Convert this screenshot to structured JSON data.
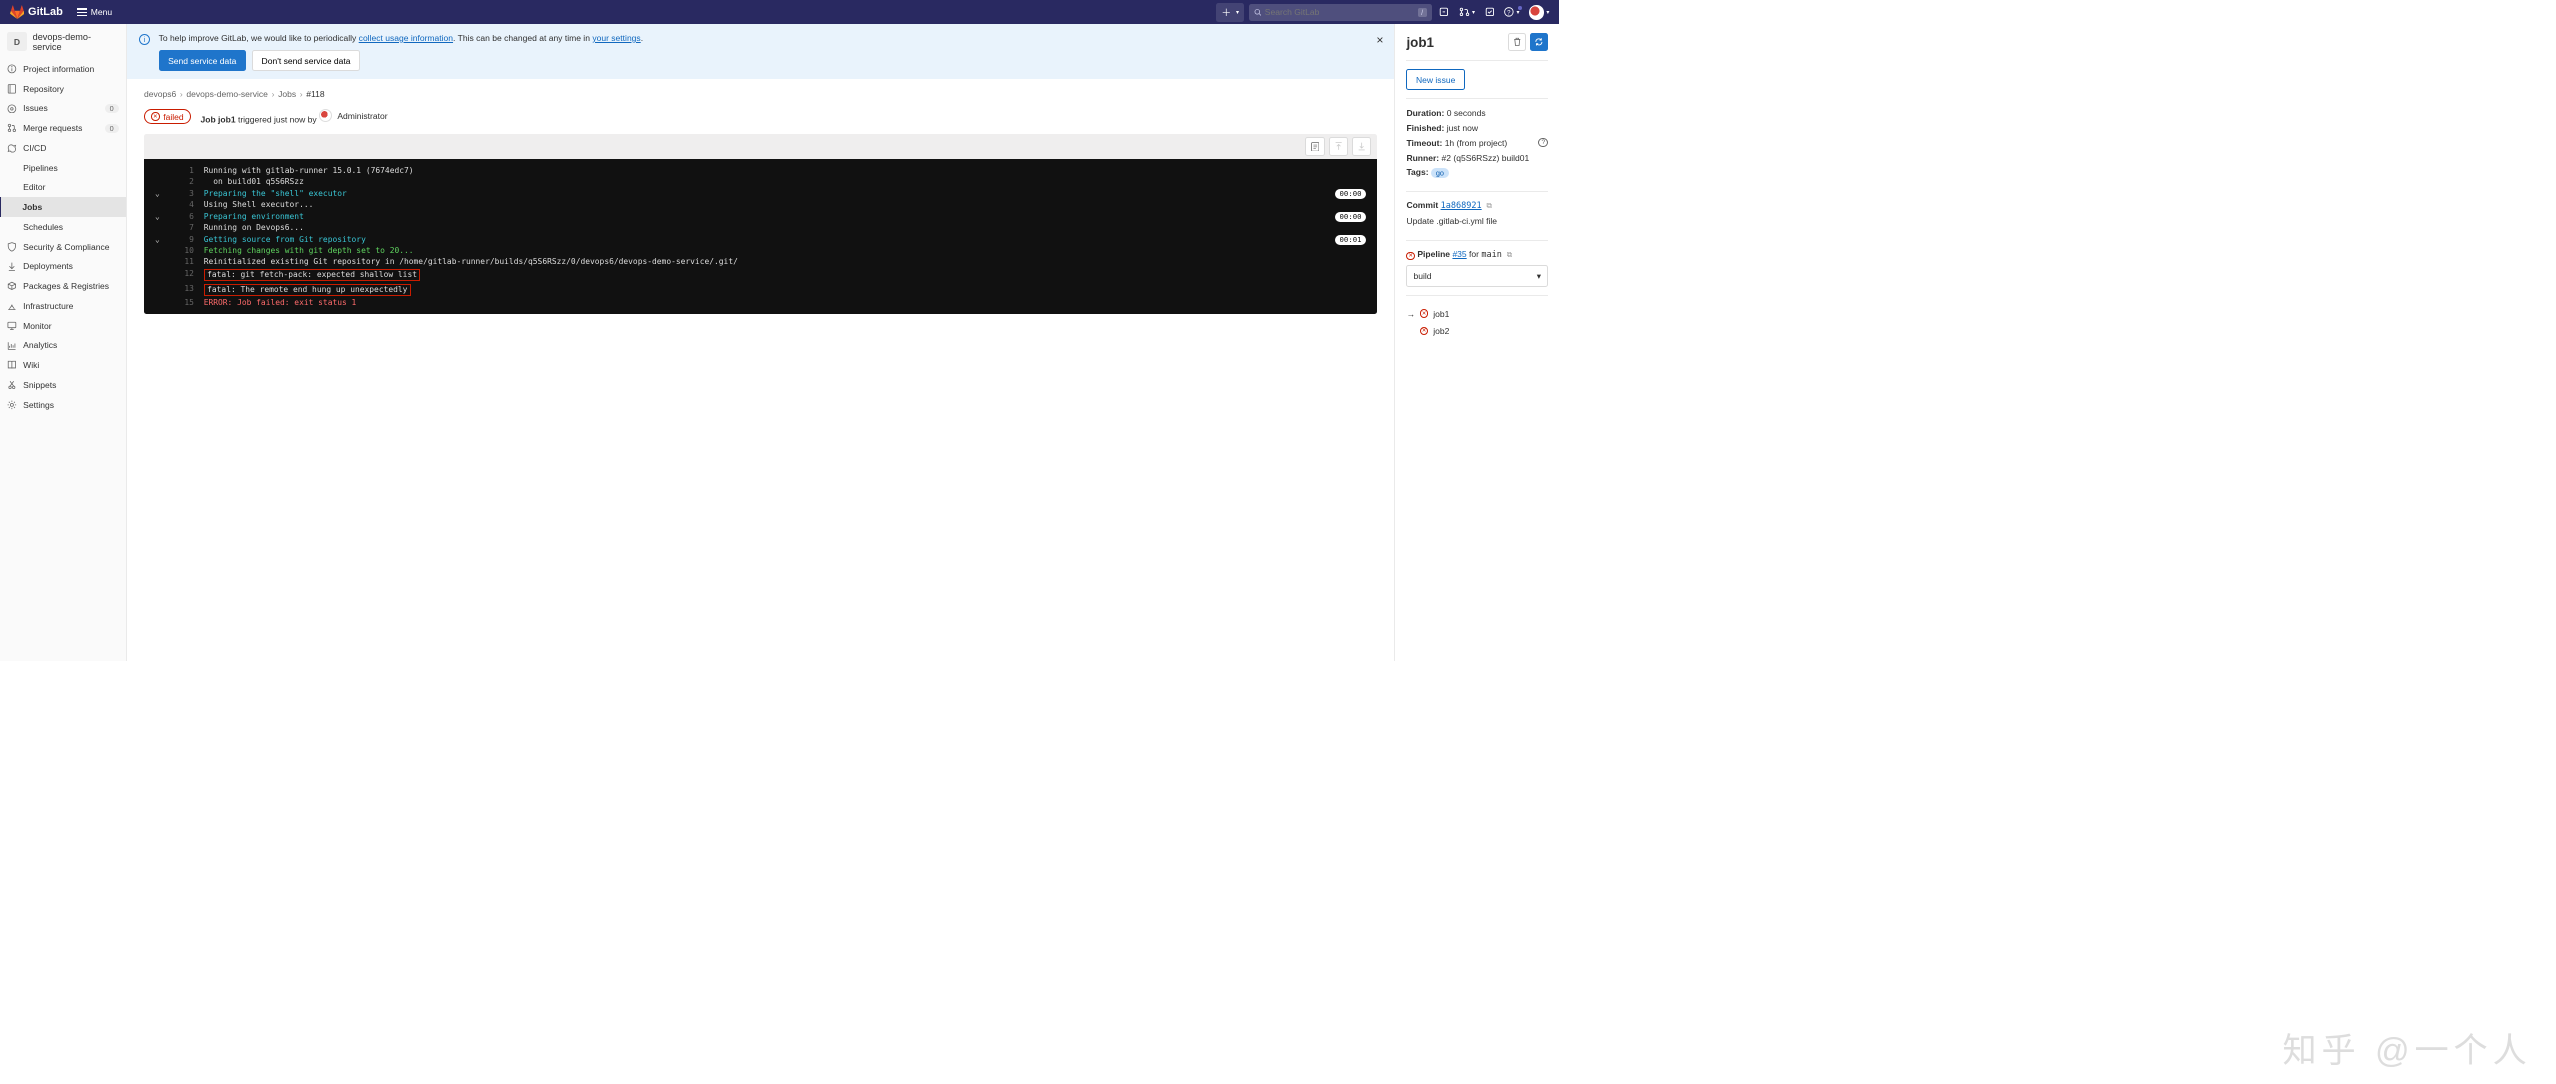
{
  "navbar": {
    "brand": "GitLab",
    "menu_label": "Menu",
    "search_placeholder": "Search GitLab",
    "slash_key": "/"
  },
  "sidebar": {
    "project_initial": "D",
    "project_name": "devops-demo-service",
    "items": [
      {
        "icon": "info",
        "label": "Project information"
      },
      {
        "icon": "repo",
        "label": "Repository"
      },
      {
        "icon": "issues",
        "label": "Issues",
        "badge": "0"
      },
      {
        "icon": "mr",
        "label": "Merge requests",
        "badge": "0"
      },
      {
        "icon": "cicd",
        "label": "CI/CD"
      }
    ],
    "cicd_sub": [
      "Pipelines",
      "Editor",
      "Jobs",
      "Schedules"
    ],
    "items2": [
      {
        "icon": "shield",
        "label": "Security & Compliance"
      },
      {
        "icon": "deploy",
        "label": "Deployments"
      },
      {
        "icon": "package",
        "label": "Packages & Registries"
      },
      {
        "icon": "infra",
        "label": "Infrastructure"
      },
      {
        "icon": "monitor",
        "label": "Monitor"
      },
      {
        "icon": "analytics",
        "label": "Analytics"
      },
      {
        "icon": "wiki",
        "label": "Wiki"
      },
      {
        "icon": "snippets",
        "label": "Snippets"
      },
      {
        "icon": "settings",
        "label": "Settings"
      }
    ]
  },
  "alert": {
    "text_pre": "To help improve GitLab, we would like to periodically ",
    "link1": "collect usage information",
    "text_mid": ". This can be changed at any time in ",
    "link2": "your settings",
    "text_post": ".",
    "btn_send": "Send service data",
    "btn_dont": "Don't send service data"
  },
  "breadcrumb": [
    "devops6",
    "devops-demo-service",
    "Jobs",
    "#118"
  ],
  "job_header": {
    "status": "failed",
    "label_pre": "Job ",
    "job_name": "job1",
    "label_mid": " triggered just now by ",
    "user": "Administrator"
  },
  "log": [
    {
      "n": "1",
      "t": "Running with gitlab-runner 15.0.1 (7674edc7)",
      "cls": ""
    },
    {
      "n": "2",
      "t": "  on build01 q5S6RSzz",
      "cls": ""
    },
    {
      "n": "3",
      "t": "Preparing the \"shell\" executor",
      "cls": "c-cyan",
      "chev": true,
      "time": "00:00"
    },
    {
      "n": "4",
      "t": "Using Shell executor...",
      "cls": ""
    },
    {
      "n": "6",
      "t": "Preparing environment",
      "cls": "c-cyan",
      "chev": true,
      "time": "00:00"
    },
    {
      "n": "7",
      "t": "Running on Devops6...",
      "cls": ""
    },
    {
      "n": "9",
      "t": "Getting source from Git repository",
      "cls": "c-cyan",
      "chev": true,
      "time": "00:01"
    },
    {
      "n": "10",
      "t": "Fetching changes with git depth set to 20...",
      "cls": "c-green"
    },
    {
      "n": "11",
      "t": "Reinitialized existing Git repository in /home/gitlab-runner/builds/q5S6RSzz/0/devops6/devops-demo-service/.git/",
      "cls": ""
    },
    {
      "n": "12",
      "t": "fatal: git fetch-pack: expected shallow list",
      "cls": "",
      "fatal": true
    },
    {
      "n": "13",
      "t": "fatal: The remote end hung up unexpectedly",
      "cls": "",
      "fatal": true
    },
    {
      "n": "15",
      "t": "ERROR: Job failed: exit status 1",
      "cls": "c-red"
    }
  ],
  "rp": {
    "title": "job1",
    "new_issue": "New issue",
    "duration_l": "Duration:",
    "duration_v": "0 seconds",
    "finished_l": "Finished:",
    "finished_v": "just now",
    "timeout_l": "Timeout:",
    "timeout_v": "1h (from project)",
    "runner_l": "Runner:",
    "runner_v": "#2 (q5S6RSzz) build01",
    "tags_l": "Tags:",
    "tag": "go",
    "commit_l": "Commit",
    "commit_sha": "1a868921",
    "commit_msg": "Update .gitlab-ci.yml file",
    "pipeline_l": "Pipeline",
    "pipeline_id": "#35",
    "pipeline_for": "for",
    "pipeline_branch": "main",
    "stage": "build",
    "jobs": [
      "job1",
      "job2"
    ]
  },
  "watermark": "知乎 @一个人"
}
